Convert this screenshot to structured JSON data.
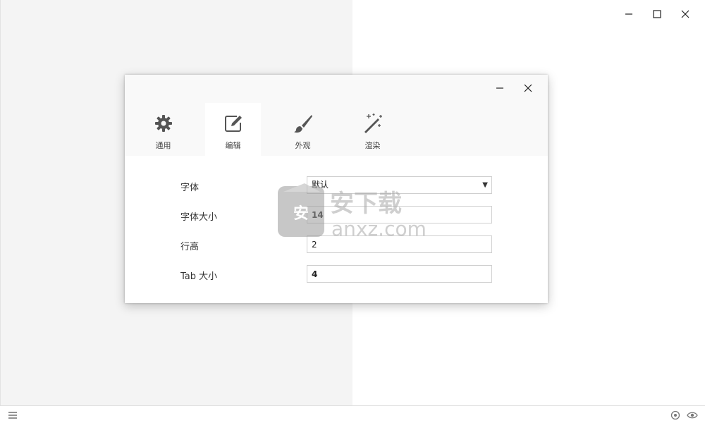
{
  "window": {
    "controls": {
      "minimize_icon": "minimize-icon",
      "maximize_icon": "maximize-icon",
      "close_icon": "close-icon"
    }
  },
  "dialog": {
    "tabs": [
      {
        "label": "通用",
        "icon": "gear-icon",
        "active": false
      },
      {
        "label": "编辑",
        "icon": "edit-icon",
        "active": true
      },
      {
        "label": "外观",
        "icon": "brush-icon",
        "active": false
      },
      {
        "label": "渲染",
        "icon": "magic-wand-icon",
        "active": false
      }
    ],
    "fields": {
      "font": {
        "label": "字体",
        "value": "默认"
      },
      "font_size": {
        "label": "字体大小",
        "value": "14"
      },
      "line_height": {
        "label": "行高",
        "value": "2"
      },
      "tab_size": {
        "label": "Tab 大小",
        "value": "4"
      }
    }
  },
  "watermark": {
    "text_cn": "安下载",
    "text_en": "anxz.com",
    "badge": "安"
  },
  "statusbar": {
    "menu_icon": "hamburger-icon",
    "right_icons": [
      "target-icon",
      "eye-icon"
    ]
  },
  "colors": {
    "left_pane": "#f4f4f4",
    "dialog_header": "#f9f9f9",
    "icon": "#555555"
  }
}
